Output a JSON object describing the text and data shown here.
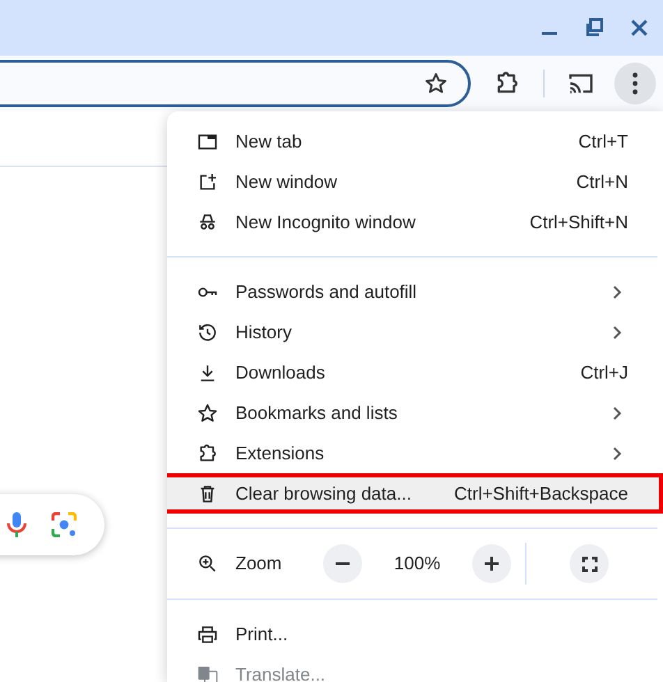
{
  "menu": {
    "items": [
      {
        "kind": "item",
        "label": "New tab",
        "shortcut": "Ctrl+T",
        "submenu": false,
        "disabled": false,
        "highlighted": false
      },
      {
        "kind": "item",
        "label": "New window",
        "shortcut": "Ctrl+N",
        "submenu": false,
        "disabled": false,
        "highlighted": false
      },
      {
        "kind": "item",
        "label": "New Incognito window",
        "shortcut": "Ctrl+Shift+N",
        "submenu": false,
        "disabled": false,
        "highlighted": false
      },
      {
        "kind": "divider"
      },
      {
        "kind": "item",
        "label": "Passwords and autofill",
        "submenu": true,
        "disabled": false,
        "highlighted": false
      },
      {
        "kind": "item",
        "label": "History",
        "submenu": true,
        "disabled": false,
        "highlighted": false
      },
      {
        "kind": "item",
        "label": "Downloads",
        "shortcut": "Ctrl+J",
        "submenu": false,
        "disabled": false,
        "highlighted": false
      },
      {
        "kind": "item",
        "label": "Bookmarks and lists",
        "submenu": true,
        "disabled": false,
        "highlighted": false
      },
      {
        "kind": "item",
        "label": "Extensions",
        "submenu": true,
        "disabled": false,
        "highlighted": false
      },
      {
        "kind": "item",
        "label": "Clear browsing data...",
        "shortcut": "Ctrl+Shift+Backspace",
        "submenu": false,
        "disabled": false,
        "highlighted": true
      },
      {
        "kind": "divider"
      },
      {
        "kind": "zoom",
        "label": "Zoom",
        "value": "100%"
      },
      {
        "kind": "divider"
      },
      {
        "kind": "item",
        "label": "Print...",
        "submenu": false,
        "disabled": false,
        "highlighted": false
      },
      {
        "kind": "item",
        "label": "Translate...",
        "submenu": false,
        "disabled": true,
        "highlighted": false
      }
    ]
  }
}
